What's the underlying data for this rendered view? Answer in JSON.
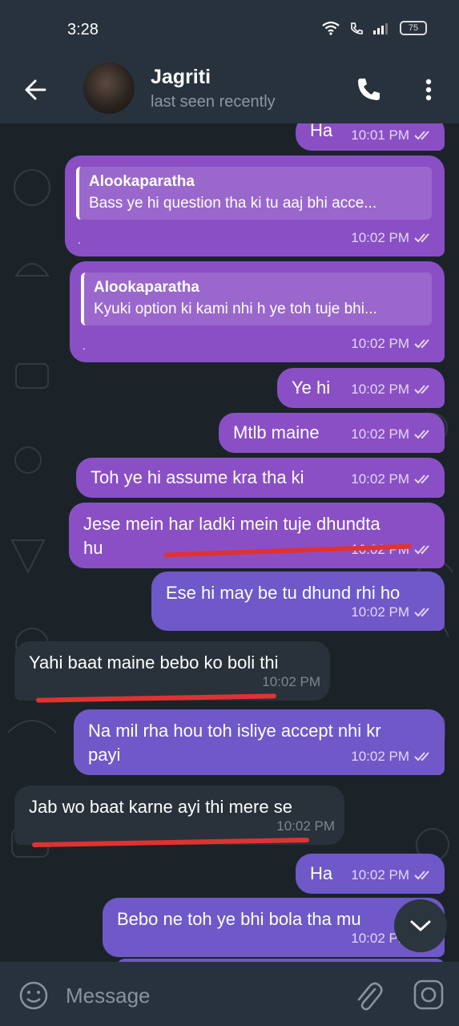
{
  "status_bar": {
    "time": "3:28",
    "battery": "75"
  },
  "header": {
    "name": "Jagriti",
    "status": "last seen recently"
  },
  "messages": [
    {
      "dir": "out",
      "text": "Ha",
      "time": "10:01 PM"
    },
    {
      "dir": "out",
      "reply": {
        "author": "Alookaparatha",
        "text": "Bass ye hi question tha ki tu aaj bhi acce..."
      },
      "text": ".",
      "time": "10:02 PM"
    },
    {
      "dir": "out",
      "reply": {
        "author": "Alookaparatha",
        "text": "Kyuki option ki kami nhi h ye toh tuje bhi..."
      },
      "text": ".",
      "time": "10:02 PM"
    },
    {
      "dir": "out",
      "text": "Ye hi",
      "time": "10:02 PM"
    },
    {
      "dir": "out",
      "text": "Mtlb maine",
      "time": "10:02 PM"
    },
    {
      "dir": "out",
      "text": "Toh ye hi assume kra tha ki",
      "time": "10:02 PM"
    },
    {
      "dir": "out",
      "text": "Jese mein har ladki mein tuje dhundta\nhu",
      "time": "10:02 PM"
    },
    {
      "dir": "out",
      "text": "Ese hi may be tu dhund rhi ho",
      "time": "10:02 PM"
    },
    {
      "dir": "in",
      "text": "Yahi baat maine bebo ko boli thi",
      "time": "10:02 PM"
    },
    {
      "dir": "out",
      "text": "Na mil rha hou toh isliye accept nhi kr\npayi",
      "time": "10:02 PM"
    },
    {
      "dir": "in",
      "text": "Jab wo baat karne ayi thi mere se",
      "time": "10:02 PM"
    },
    {
      "dir": "out",
      "text": "Ha",
      "time": "10:02 PM"
    },
    {
      "dir": "out",
      "text": "Bebo ne toh ye bhi bola tha mu",
      "time": "10:02 PM"
    }
  ],
  "composer": {
    "placeholder": "Message"
  },
  "colors": {
    "outgoing": "#8a4fc5",
    "outgoing_alt": "#6f58c8",
    "incoming": "#29323a",
    "background": "#1b2329",
    "bar": "#27323d",
    "annotation": "#e03232"
  },
  "icons": [
    "back-arrow-icon",
    "phone-icon",
    "more-vertical-icon",
    "double-check-icon",
    "chevron-down-icon",
    "emoji-icon",
    "paperclip-icon",
    "camera-icon",
    "wifi-icon",
    "signal-icon",
    "battery-icon"
  ]
}
